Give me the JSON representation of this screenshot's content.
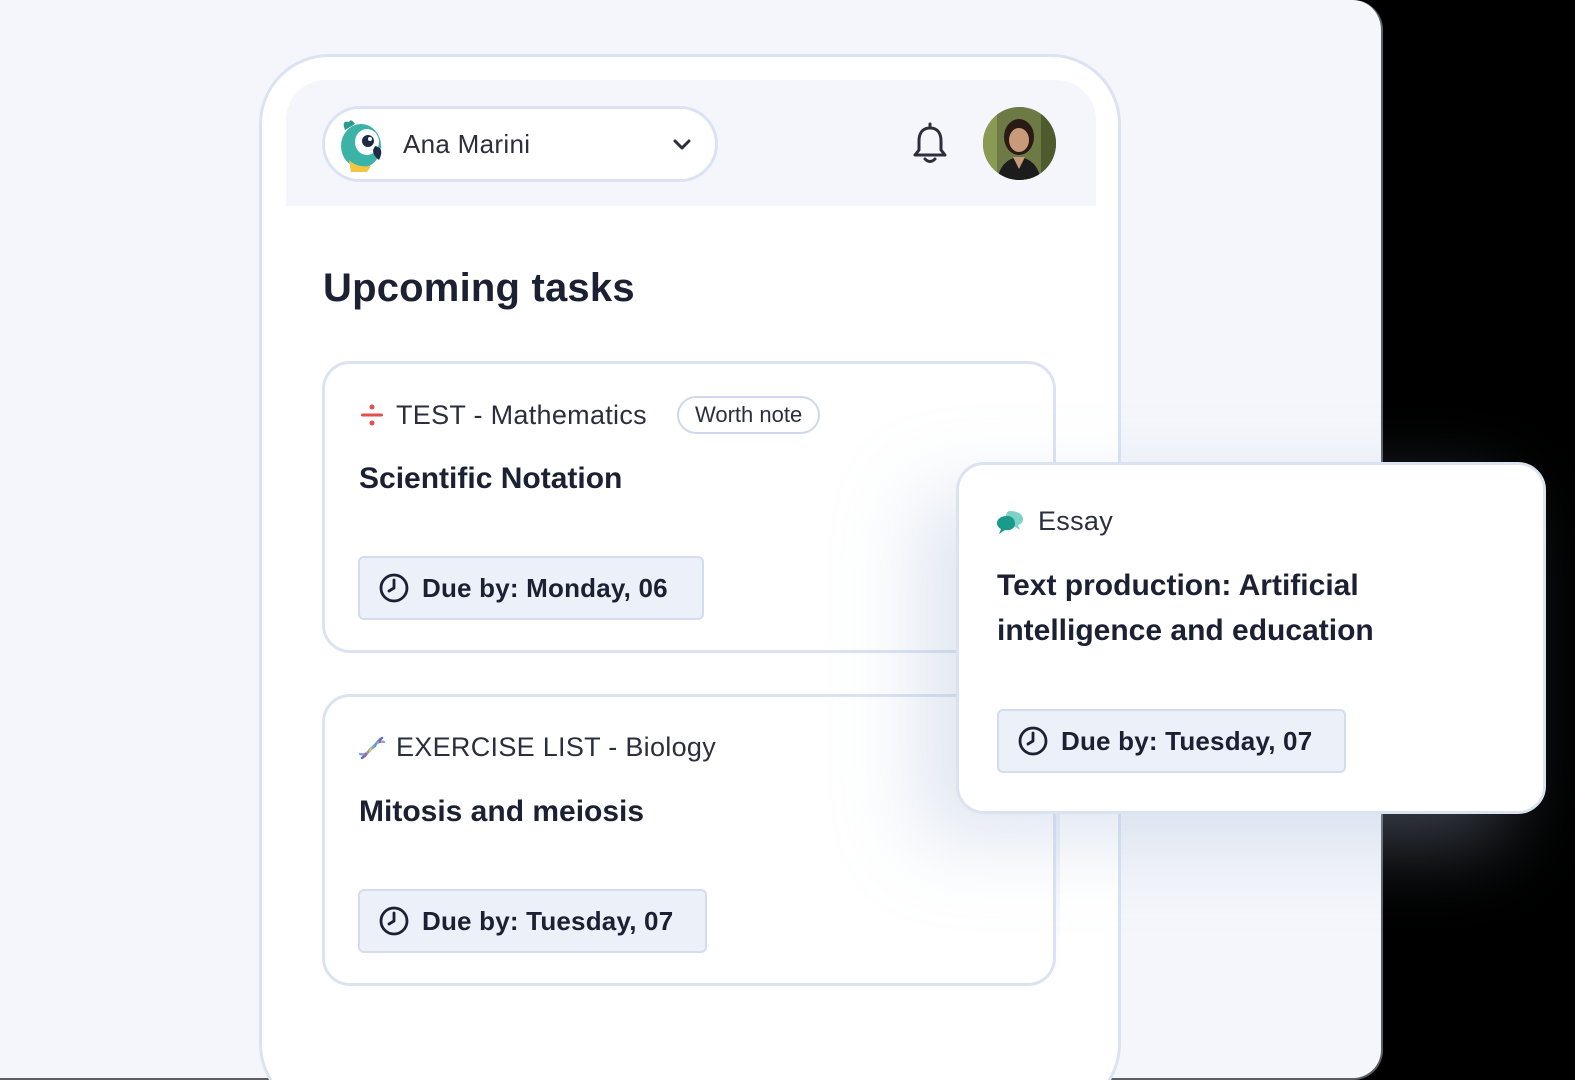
{
  "header": {
    "user_name": "Ana Marini",
    "icons": {
      "mascot": "parrot-mascot-icon",
      "dropdown": "chevron-down-icon",
      "notifications": "bell-icon",
      "avatar": "user-avatar"
    }
  },
  "section_title": "Upcoming tasks",
  "tasks": [
    {
      "type": "TEST - Mathematics",
      "icon": "divide-icon",
      "icon_color": "#e0514b",
      "badge": "Worth note",
      "title": "Scientific Notation",
      "due": "Due by: Monday, 06"
    },
    {
      "type": "EXERCISE LIST - Biology",
      "icon": "dna-icon",
      "icon_color": "#4a73c9",
      "title": "Mitosis and meiosis",
      "due": "Due by: Tuesday, 07"
    },
    {
      "type": "Essay",
      "icon": "speech-bubbles-icon",
      "icon_color": "#1a9a8a",
      "title": "Text production: Artificial intelligence and education",
      "due": "Due by: Tuesday, 07"
    }
  ],
  "colors": {
    "page_bg": "#f4f6fb",
    "card_border": "#dbe3f2",
    "due_bg": "#ecf0f9",
    "text_primary": "#1c2033"
  }
}
